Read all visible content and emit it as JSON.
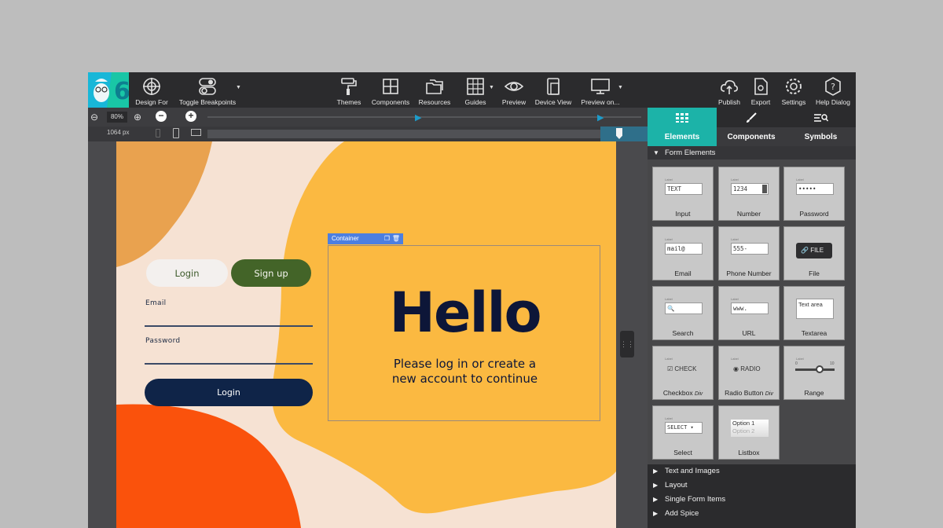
{
  "toolbar": {
    "design_for": "Design For",
    "toggle_breakpoints": "Toggle Breakpoints",
    "themes": "Themes",
    "components": "Components",
    "resources": "Resources",
    "guides": "Guides",
    "preview": "Preview",
    "device_view": "Device View",
    "preview_on": "Preview on...",
    "publish": "Publish",
    "export": "Export",
    "settings": "Settings",
    "help": "Help Dialog"
  },
  "zoom": {
    "level": "80%",
    "width": "1064 px"
  },
  "canvas": {
    "tab_login": "Login",
    "tab_signup": "Sign up",
    "email_label": "Email",
    "password_label": "Password",
    "login_button": "Login",
    "container_tag": "Container",
    "hello": "Hello",
    "subtitle_line1": "Please log in or create a",
    "subtitle_line2": "new account to continue"
  },
  "panel": {
    "tabs": [
      "Elements",
      "Components",
      "Symbols"
    ],
    "section": "Form Elements",
    "tiles": [
      {
        "label": "Input",
        "sample": "TEXT"
      },
      {
        "label": "Number",
        "sample": "1234"
      },
      {
        "label": "Password",
        "sample": "•••••"
      },
      {
        "label": "Email",
        "sample": "mail@"
      },
      {
        "label": "Phone Number",
        "sample": "555-"
      },
      {
        "label": "File",
        "sample": "FILE"
      },
      {
        "label": "Search",
        "sample": ""
      },
      {
        "label": "URL",
        "sample": "www."
      },
      {
        "label": "Textarea",
        "sample": "Text area"
      },
      {
        "label": "Checkbox",
        "label_em": "Div",
        "sample": "CHECK"
      },
      {
        "label": "Radio Button",
        "label_em": "Div",
        "sample": "RADIO"
      },
      {
        "label": "Range",
        "sample": ""
      },
      {
        "label": "Select",
        "sample": "SELECT"
      },
      {
        "label": "Listbox",
        "sample": "Option 1",
        "sample2": "Option 2"
      }
    ],
    "range_min": "0",
    "range_max": "10",
    "sections": [
      "Text and Images",
      "Layout",
      "Single Form Items",
      "Add Spice"
    ]
  },
  "colors": {
    "accent": "#1cb3a8",
    "canvas_bg": "#f6e2d3",
    "blob_yellow": "#fbb941",
    "blob_orange": "#e9a24f",
    "blob_red": "#fa520c",
    "signup_green": "#436428",
    "login_navy": "#0f2448"
  }
}
